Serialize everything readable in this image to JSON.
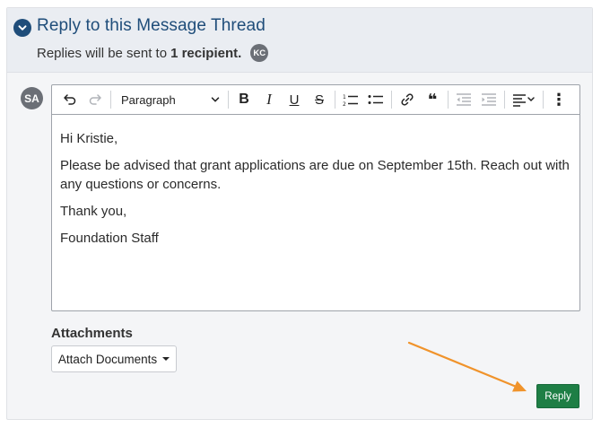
{
  "thread": {
    "title": "Reply to this Message Thread",
    "recipients_prefix": "Replies will be sent to",
    "recipients_count": "1 recipient.",
    "recipient_initials": "KC"
  },
  "author": {
    "initials": "SA"
  },
  "toolbar": {
    "format_select": "Paragraph",
    "buttons": [
      {
        "name": "undo",
        "icon": "undo-icon",
        "enabled": true
      },
      {
        "name": "redo",
        "icon": "redo-icon",
        "enabled": false
      },
      {
        "name": "bold",
        "icon": "bold-icon",
        "glyph": "B"
      },
      {
        "name": "italic",
        "icon": "italic-icon",
        "glyph": "I"
      },
      {
        "name": "underline",
        "icon": "underline-icon",
        "glyph": "U"
      },
      {
        "name": "strikethrough",
        "icon": "strikethrough-icon",
        "glyph": "S"
      },
      {
        "name": "numbered-list",
        "icon": "numbered-list-icon"
      },
      {
        "name": "bulleted-list",
        "icon": "bulleted-list-icon"
      },
      {
        "name": "link",
        "icon": "link-icon"
      },
      {
        "name": "quote",
        "icon": "quote-icon",
        "glyph": "❝"
      },
      {
        "name": "outdent",
        "icon": "outdent-icon",
        "enabled": false
      },
      {
        "name": "indent",
        "icon": "indent-icon",
        "enabled": false
      },
      {
        "name": "align",
        "icon": "align-left-icon"
      },
      {
        "name": "more",
        "icon": "more-vertical-icon",
        "glyph": "⋮"
      }
    ]
  },
  "message": {
    "greeting": "Hi Kristie,",
    "body": "Please be advised that grant applications are due on September 15th. Reach out with any questions or concerns.",
    "closing": "Thank you,",
    "signature": "Foundation Staff"
  },
  "attachments": {
    "label": "Attachments",
    "button_label": "Attach Documents"
  },
  "actions": {
    "reply_label": "Reply"
  },
  "colors": {
    "title": "#1f4d7a",
    "reply_button": "#1e7e45",
    "arrow": "#f0932b"
  }
}
